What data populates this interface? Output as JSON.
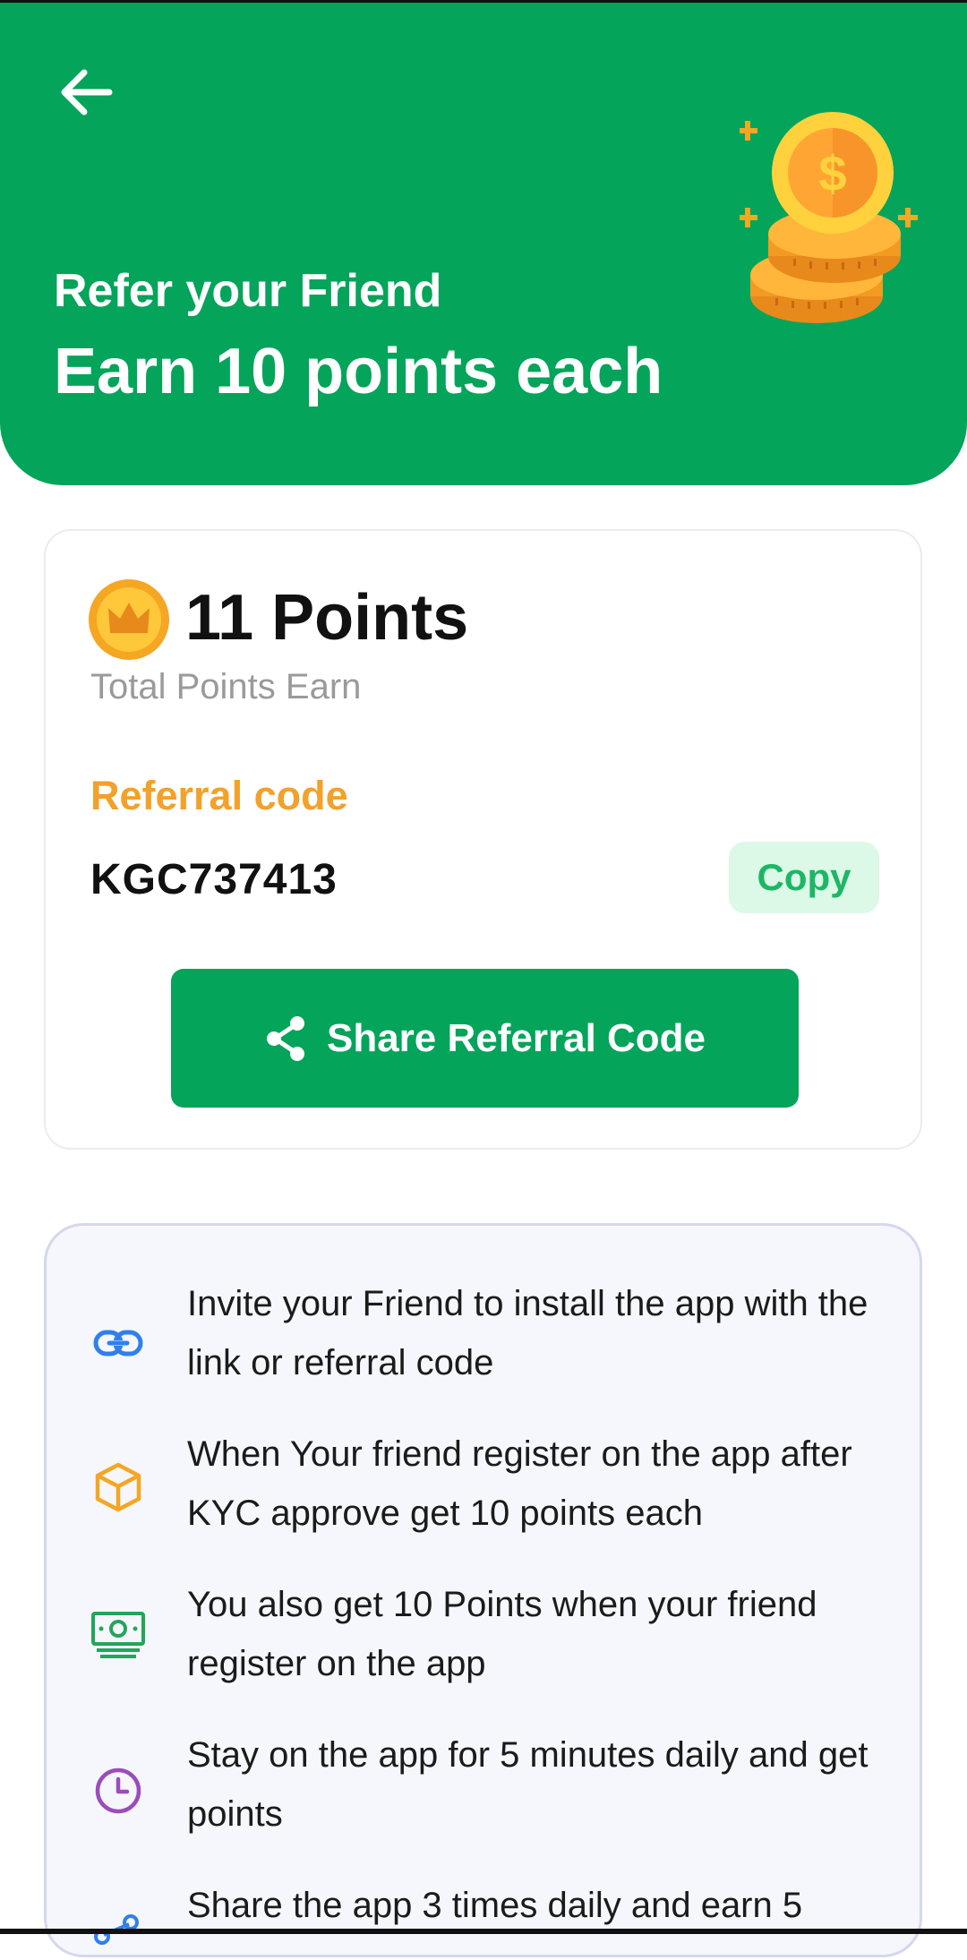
{
  "header": {
    "title": "Refer your Friend",
    "subtitle": "Earn 10 points each"
  },
  "points": {
    "value": "11 Points",
    "caption": "Total Points Earn"
  },
  "referral": {
    "label": "Referral code",
    "code": "KGC737413",
    "copy_label": "Copy",
    "share_label": "Share Referral Code"
  },
  "steps": [
    {
      "icon": "link-icon",
      "text": "Invite your Friend to install the app with the link or referral code"
    },
    {
      "icon": "box-icon",
      "text": "When Your friend register on the app after KYC approve get 10 points each"
    },
    {
      "icon": "money-icon",
      "text": "You also get 10 Points when your friend register on the app"
    },
    {
      "icon": "clock-icon",
      "text": "Stay on the app for 5 minutes daily and get points"
    },
    {
      "icon": "share-icon",
      "text": "Share the app 3 times daily and earn 5"
    }
  ],
  "colors": {
    "brand_green": "#04A45A",
    "accent_orange": "#F2A12B",
    "copy_bg": "#DBF9E6",
    "copy_text": "#1DB665",
    "steps_bg": "#F6F7FC"
  }
}
